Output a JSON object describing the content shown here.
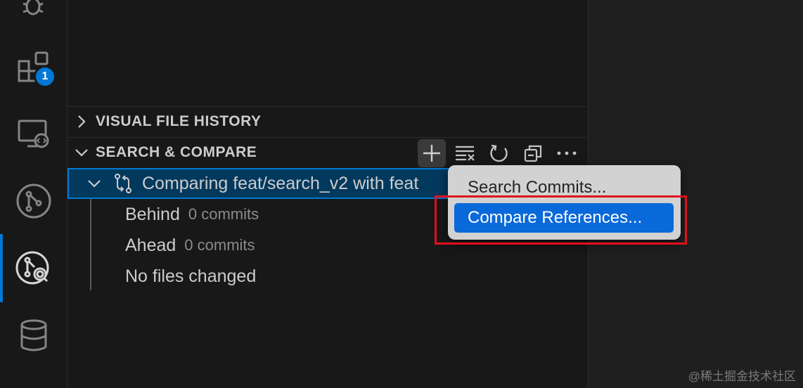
{
  "activity_bar": {
    "items": [
      {
        "icon": "debug-icon"
      },
      {
        "icon": "extensions-icon",
        "badge": "1"
      },
      {
        "icon": "remote-explorer-icon"
      },
      {
        "icon": "source-control-icon"
      },
      {
        "icon": "gitlens-inspect-icon",
        "active": true
      },
      {
        "icon": "database-icon"
      }
    ]
  },
  "sidebar": {
    "sections": [
      {
        "title": "VISUAL FILE HISTORY",
        "expanded": false
      },
      {
        "title": "SEARCH & COMPARE",
        "expanded": true,
        "toolbar": [
          "add-icon",
          "clear-all-icon",
          "refresh-icon",
          "collapse-all-icon",
          "more-actions-icon"
        ]
      }
    ],
    "tree": {
      "comparison_label": "Comparing feat/search_v2 with feat",
      "rows": [
        {
          "label": "Behind",
          "description": "0 commits"
        },
        {
          "label": "Ahead",
          "description": "0 commits"
        },
        {
          "label": "No files changed",
          "description": ""
        }
      ]
    }
  },
  "context_menu": {
    "items": [
      {
        "label": "Search Commits...",
        "highlighted": false
      },
      {
        "label": "Compare References...",
        "highlighted": true
      }
    ]
  },
  "watermark": "@稀土掘金技术社区",
  "colors": {
    "accent": "#0078d4",
    "menu_highlight": "#0a69d9",
    "annotation_red": "#e0101b"
  }
}
